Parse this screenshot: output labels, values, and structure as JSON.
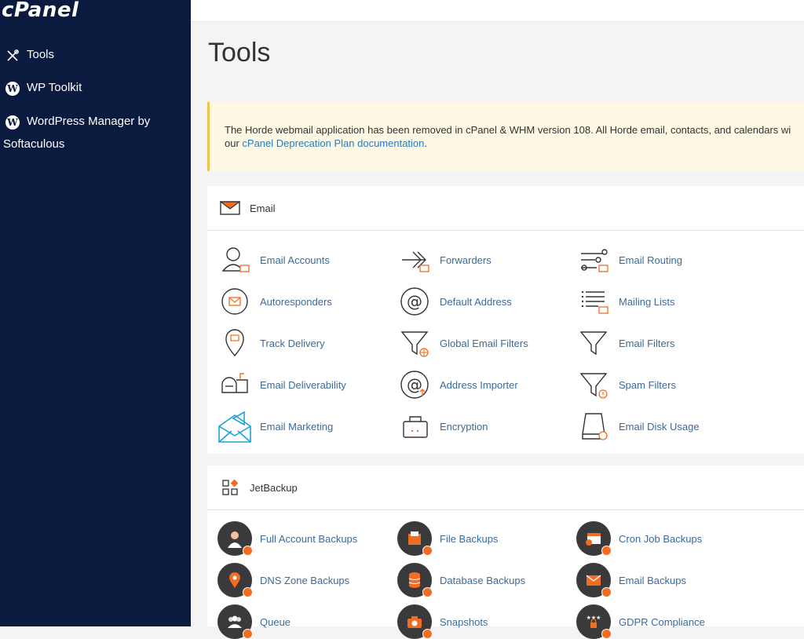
{
  "sidebar": {
    "logo": "cPanel",
    "items": [
      {
        "label": "Tools"
      },
      {
        "label": "WP Toolkit"
      },
      {
        "label": "WordPress Manager by"
      }
    ],
    "item3_line2": "Softaculous"
  },
  "page": {
    "title": "Tools"
  },
  "notice": {
    "text": "The Horde webmail application has been removed in cPanel & WHM version 108. All Horde email, contacts, and calendars wi",
    "text2_prefix": "our ",
    "link": "cPanel Deprecation Plan documentation",
    "text2_suffix": "."
  },
  "email": {
    "title": "Email",
    "tools": [
      {
        "label": "Email Accounts",
        "icon": "email-accounts-icon"
      },
      {
        "label": "Forwarders",
        "icon": "forwarders-icon"
      },
      {
        "label": "Email Routing",
        "icon": "email-routing-icon"
      },
      {
        "label": "Autoresponders",
        "icon": "autoresponders-icon"
      },
      {
        "label": "Default Address",
        "icon": "default-address-icon"
      },
      {
        "label": "Mailing Lists",
        "icon": "mailing-lists-icon"
      },
      {
        "label": "Track Delivery",
        "icon": "track-delivery-icon"
      },
      {
        "label": "Global Email Filters",
        "icon": "global-email-filters-icon"
      },
      {
        "label": "Email Filters",
        "icon": "email-filters-icon"
      },
      {
        "label": "Email Deliverability",
        "icon": "email-deliverability-icon"
      },
      {
        "label": "Address Importer",
        "icon": "address-importer-icon"
      },
      {
        "label": "Spam Filters",
        "icon": "spam-filters-icon"
      },
      {
        "label": "Email Marketing",
        "icon": "email-marketing-icon"
      },
      {
        "label": "Encryption",
        "icon": "encryption-icon"
      },
      {
        "label": "Email Disk Usage",
        "icon": "email-disk-usage-icon"
      }
    ]
  },
  "jetbackup": {
    "title": "JetBackup",
    "tools": [
      {
        "label": "Full Account Backups",
        "icon": "full-account-backups-icon"
      },
      {
        "label": "File Backups",
        "icon": "file-backups-icon"
      },
      {
        "label": "Cron Job Backups",
        "icon": "cron-job-backups-icon"
      },
      {
        "label": "DNS Zone Backups",
        "icon": "dns-zone-backups-icon"
      },
      {
        "label": "Database Backups",
        "icon": "database-backups-icon"
      },
      {
        "label": "Email Backups",
        "icon": "email-backups-icon"
      },
      {
        "label": "Queue",
        "icon": "queue-icon"
      },
      {
        "label": "Snapshots",
        "icon": "snapshots-icon"
      },
      {
        "label": "GDPR Compliance",
        "icon": "gdpr-compliance-icon"
      }
    ]
  },
  "colors": {
    "sidebar": "#0b1a3f",
    "accent": "#f26c22",
    "link": "#3d6a9a"
  }
}
